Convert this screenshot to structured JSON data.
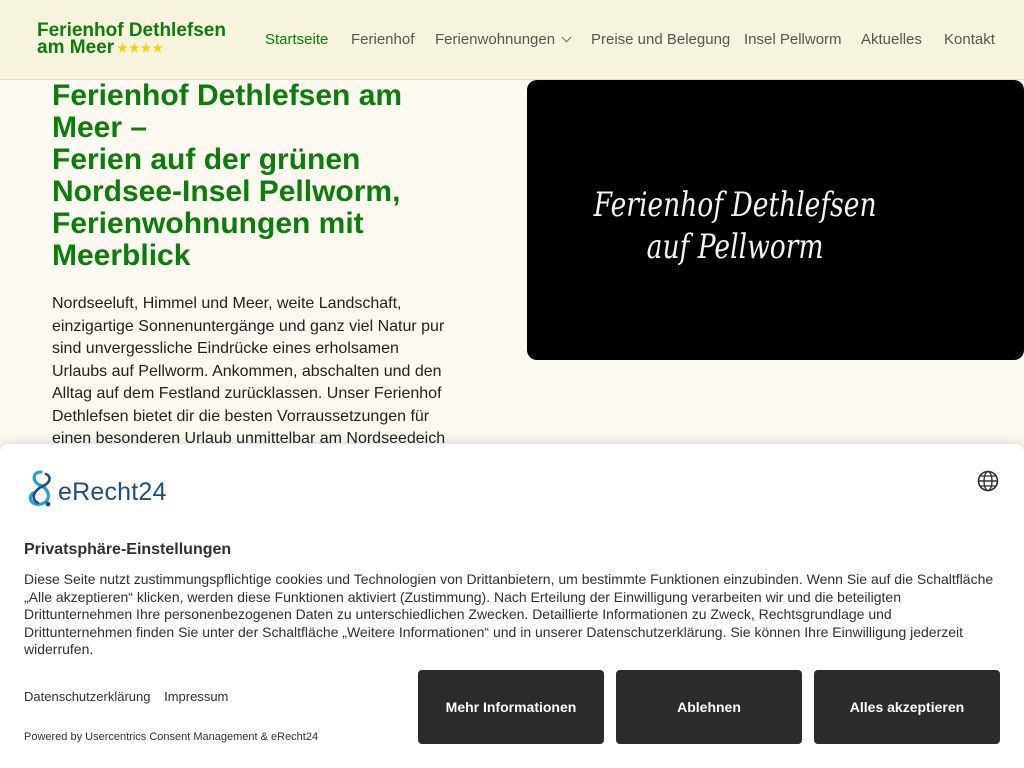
{
  "header": {
    "logo_line1": "Ferienhof Dethlefsen",
    "logo_line2": "am Meer",
    "logo_stars": "★★★★",
    "nav": [
      {
        "label": "Startseite",
        "active": true
      },
      {
        "label": "Ferienhof"
      },
      {
        "label": "Ferienwohnungen",
        "has_dropdown": true
      },
      {
        "label": "Preise und Belegung"
      },
      {
        "label": "Insel Pellworm"
      },
      {
        "label": "Aktuelles"
      },
      {
        "label": "Kontakt"
      }
    ]
  },
  "main": {
    "title_line1": "Ferienhof Dethlefsen am Meer –",
    "title_line2": "Ferien auf der grünen Nordsee-Insel Pellworm, Ferienwohnungen mit Meerblick",
    "intro": "Nordseeluft, Himmel und Meer, weite Landschaft, einzigartige Sonnenuntergänge und ganz viel Natur pur sind unvergessliche Eindrücke eines erholsamen Urlaubs auf Pellworm. Ankommen, abschalten und den Alltag auf dem Festland zurücklassen. Unser Ferienhof Dethlefsen bietet dir die besten Vorraussetzungen für einen besonderen Urlaub unmittelbar am Nordseedeich",
    "video_line1": "Ferienhof Dethlefsen",
    "video_line2": "auf Pellworm"
  },
  "consent": {
    "brand": "eRecht24",
    "title": "Privatsphäre-Einstellungen",
    "text": "Diese Seite nutzt zustimmungspflichtige cookies und Technologien von Drittanbietern, um bestimmte Funktionen einzubinden. Wenn Sie auf die Schaltfläche „Alle akzeptieren“ klicken, werden diese Funktionen aktiviert (Zustimmung). Nach Erteilung der Einwilligung verarbeiten wir und die beteiligten Drittunternehmen Ihre personenbezogenen Daten zu unterschiedlichen Zwecken. Detaillierte Informationen zu Zweck, Rechtsgrundlage und Drittunternehmen finden Sie unter der Schaltfläche „Weitere Informationen“ und in unserer Datenschutzerklärung. Sie können Ihre Einwilligung jederzeit widerrufen.",
    "link_privacy": "Datenschutzerklärung",
    "link_imprint": "Impressum",
    "powered": "Powered by Usercentrics Consent Management & eRecht24",
    "btn_more": "Mehr Informationen",
    "btn_decline": "Ablehnen",
    "btn_accept": "Alles akzeptieren"
  },
  "colors": {
    "brand_green": "#0b7d0b",
    "header_bg": "#f7f4dd",
    "page_bg": "#fcfaf0",
    "button_bg": "#2b2b2b",
    "erecht_blue": "#1f4f7c",
    "star_yellow": "#f2d40a"
  },
  "icons": [
    "chevron-down-icon",
    "globe-icon",
    "erecht24-logo-icon"
  ]
}
